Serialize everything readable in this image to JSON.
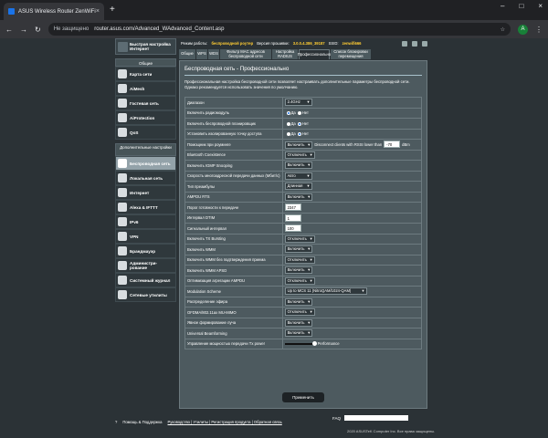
{
  "browser": {
    "tab_title": "ASUS Wireless Router ZenWiFi",
    "warn": "Не защищено",
    "url": "router.asus.com/Advanced_WAdvanced_Content.asp",
    "avatar": "A"
  },
  "left": {
    "qis": "Быстрая настройка Интернет",
    "general": "Общие",
    "items": [
      "Карта сети",
      "AiMesh",
      "Гостевая сеть",
      "AiProtection",
      "QoS"
    ],
    "advanced": "Дополнительные настройки",
    "adv_items": [
      "Беспроводная сеть",
      "Локальная сеть",
      "Интернет",
      "Alexa & IFTTT",
      "IPv6",
      "VPN",
      "Брандмауэр",
      "Администри-рование",
      "Системный журнал",
      "Сетевые утилиты"
    ]
  },
  "top": {
    "mode_label": "Режим работы:",
    "mode": "беспроводной роутер",
    "fw_label": "Версия прошивки:",
    "fw": "3.0.0.4.386_39187",
    "ssid_label": "SSID:",
    "ssid": "zenwifi666"
  },
  "tabs": [
    "Общие",
    "WPS",
    "WDS",
    "Фильтр MAC адресов беспроводной сети",
    "Настройка RADIUS",
    "Профессионально",
    "Список блокировки перемещения"
  ],
  "panel": {
    "title": "Беспроводная сеть - Профессионально",
    "desc": "Профессиональная настройка беспроводной сети позволяет настраивать дополнительные параметры беспроводной сети. Однако рекомендуется использовать значения по умолчанию.",
    "apply": "Применить"
  },
  "rows": [
    {
      "label": "Диапазон",
      "type": "select",
      "value": "2.4GHz"
    },
    {
      "label": "Включить радиомодуль",
      "type": "radio",
      "a": "Да",
      "b": "Нет",
      "on": "a"
    },
    {
      "label": "Включить беспроводной планировщик",
      "type": "radio",
      "a": "Да",
      "b": "Нет",
      "on": "b"
    },
    {
      "label": "Установить изолированную точку доступа",
      "type": "radio",
      "a": "Да",
      "b": "Нет",
      "on": "b"
    },
    {
      "label": "Помощник при роуминге",
      "type": "roam",
      "value": "Включить",
      "text": "Disconnect clients with RSSI lower than",
      "rssi": "-70",
      "unit": "dBm"
    },
    {
      "label": "Bluetooth Coexistence",
      "type": "select",
      "value": "Отключить"
    },
    {
      "label": "Включить IGMP Snooping",
      "type": "select",
      "value": "Включить"
    },
    {
      "label": "Скорость многоадресной передачи данных (Мбит/с)",
      "type": "select",
      "value": "Авто"
    },
    {
      "label": "Тип преамбулы",
      "type": "select",
      "value": "Длинная"
    },
    {
      "label": "AMPDU RTS",
      "type": "select",
      "value": "Включить"
    },
    {
      "label": "Порог готовности к передаче",
      "type": "input",
      "value": "2347"
    },
    {
      "label": "Интервал DTIM",
      "type": "input",
      "value": "1"
    },
    {
      "label": "Сигнальный интервал",
      "type": "input",
      "value": "100"
    },
    {
      "label": "Включить TX Bursting",
      "type": "select",
      "value": "Отключить"
    },
    {
      "label": "Включить WMM",
      "type": "select",
      "value": "Включить"
    },
    {
      "label": "Включить WMM без подтверждения приема",
      "type": "select",
      "value": "Отключить"
    },
    {
      "label": "Включить WMM APSD",
      "type": "select",
      "value": "Включить"
    },
    {
      "label": "Оптимизация агрегации AMPDU",
      "type": "select",
      "value": "Отключить"
    },
    {
      "label": "Modulation Scheme",
      "type": "select",
      "value": "Up to MCS 11 (NitroQAM/1024-QAM)"
    },
    {
      "label": "Распределение эфира",
      "type": "select",
      "value": "Включить"
    },
    {
      "label": "OFDMA/802.11ax MU-MIMO",
      "type": "select",
      "value": "Отключить"
    },
    {
      "label": "Явное формирование луча",
      "type": "select",
      "value": "Включить"
    },
    {
      "label": "Universal Beamforming",
      "type": "select",
      "value": "Включить"
    },
    {
      "label": "Управление мощностью передачи Tx power",
      "type": "slider",
      "value": "Performance"
    }
  ],
  "footer": {
    "help": "Помощь & Поддержка",
    "links": "Руководство | Утилиты | Регистрация продукта | Обратная связь",
    "faq": "FAQ",
    "copy": "2020 ASUSTeK Computer Inc. Все права защищены."
  }
}
